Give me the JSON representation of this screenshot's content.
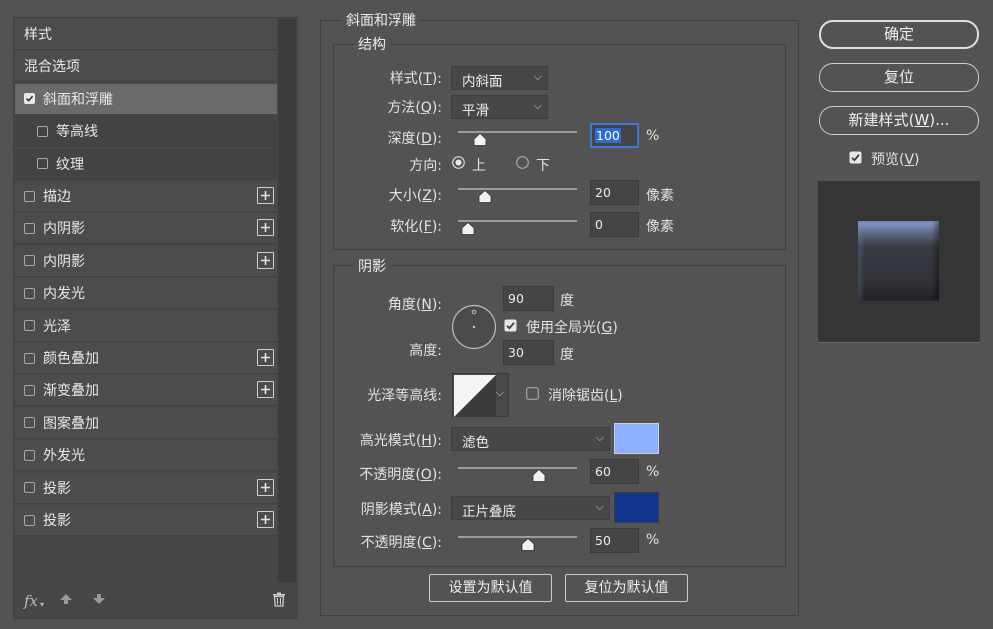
{
  "style_list": {
    "items": [
      {
        "label": "样式",
        "checkbox": false,
        "plus": false
      },
      {
        "label": "混合选项",
        "checkbox": false,
        "plus": false
      },
      {
        "label": "斜面和浮雕",
        "checkbox": true,
        "checked": true,
        "selected": true,
        "plus": false
      },
      {
        "label": "等高线",
        "checkbox": true,
        "checked": false,
        "sub": true,
        "plus": false
      },
      {
        "label": "纹理",
        "checkbox": true,
        "checked": false,
        "sub": true,
        "plus": false
      },
      {
        "label": "描边",
        "checkbox": true,
        "checked": false,
        "plus": true
      },
      {
        "label": "内阴影",
        "checkbox": true,
        "checked": false,
        "plus": true
      },
      {
        "label": "内阴影",
        "checkbox": true,
        "checked": false,
        "plus": true
      },
      {
        "label": "内发光",
        "checkbox": true,
        "checked": false,
        "plus": false
      },
      {
        "label": "光泽",
        "checkbox": true,
        "checked": false,
        "plus": false
      },
      {
        "label": "颜色叠加",
        "checkbox": true,
        "checked": false,
        "plus": true
      },
      {
        "label": "渐变叠加",
        "checkbox": true,
        "checked": false,
        "plus": true
      },
      {
        "label": "图案叠加",
        "checkbox": true,
        "checked": false,
        "plus": false
      },
      {
        "label": "外发光",
        "checkbox": true,
        "checked": false,
        "plus": false
      },
      {
        "label": "投影",
        "checkbox": true,
        "checked": false,
        "plus": true
      },
      {
        "label": "投影",
        "checkbox": true,
        "checked": false,
        "plus": true
      }
    ],
    "fx_label": "fx"
  },
  "bevel": {
    "title": "斜面和浮雕",
    "structure": {
      "title": "结构",
      "style": {
        "label": "样式",
        "key": "T",
        "value": "内斜面"
      },
      "technique": {
        "label": "方法",
        "key": "Q",
        "value": "平滑"
      },
      "depth": {
        "label": "深度",
        "key": "D",
        "value": "100",
        "unit": "%",
        "level": 0.1
      },
      "direction": {
        "label": "方向",
        "options": [
          "上",
          "下"
        ],
        "selected": "上"
      },
      "size": {
        "label": "大小",
        "key": "Z",
        "value": "20",
        "unit": "像素",
        "level": 0.14
      },
      "soften": {
        "label": "软化",
        "key": "F",
        "value": "0",
        "unit": "像素",
        "level": 0.0
      }
    },
    "shading": {
      "title": "阴影",
      "angle": {
        "label": "角度",
        "key": "N",
        "value": "90",
        "unit": "度"
      },
      "global_light": {
        "label": "使用全局光",
        "key": "G",
        "checked": true
      },
      "altitude": {
        "label": "高度:",
        "value": "30",
        "unit": "度"
      },
      "gloss_contour": {
        "label": "光泽等高线:"
      },
      "anti_aliased": {
        "label": "消除锯齿",
        "key": "L",
        "checked": false
      },
      "highlight_mode": {
        "label": "高光模式",
        "key": "H",
        "value": "滤色",
        "color": "#8cb0ff"
      },
      "highlight_opacity": {
        "label": "不透明度",
        "key": "O",
        "value": "60",
        "unit": "%",
        "level": 0.6
      },
      "shadow_mode": {
        "label": "阴影模式",
        "key": "A",
        "value": "正片叠底",
        "color": "#10338c"
      },
      "shadow_opacity": {
        "label": "不透明度",
        "key": "C",
        "value": "50",
        "unit": "%",
        "level": 0.5
      }
    },
    "make_default": "设置为默认值",
    "reset_default": "复位为默认值"
  },
  "actions": {
    "ok": "确定",
    "reset": "复位",
    "new_style": "新建样式",
    "new_style_key": "W",
    "new_style_suffix": "...",
    "preview": {
      "label": "预览",
      "key": "V",
      "checked": true
    }
  }
}
